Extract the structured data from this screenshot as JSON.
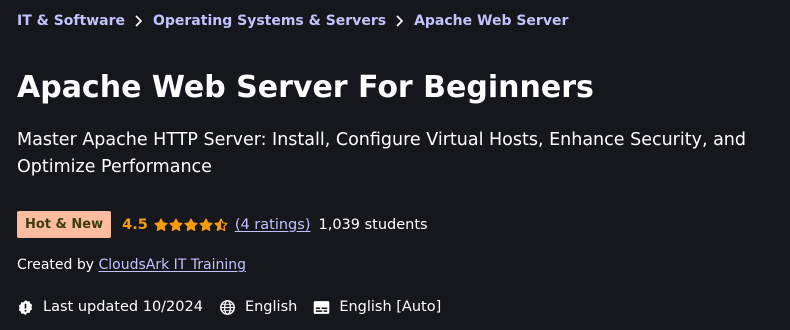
{
  "breadcrumb": {
    "items": [
      {
        "label": "IT & Software"
      },
      {
        "label": "Operating Systems & Servers"
      },
      {
        "label": "Apache Web Server"
      }
    ]
  },
  "course": {
    "title": "Apache Web Server For Beginners",
    "subtitle": "Master Apache HTTP Server: Install, Configure Virtual Hosts, Enhance Security, and Optimize Performance",
    "badge": "Hot & New",
    "rating": "4.5",
    "rating_stars": 4.5,
    "ratings_count": "(4 ratings)",
    "students": "1,039 students",
    "created_by_label": "Created by",
    "instructor": "CloudsArk IT Training",
    "last_updated": "Last updated 10/2024",
    "language": "English",
    "captions": "English [Auto]"
  },
  "colors": {
    "background": "#16161d",
    "link": "#c0c4fc",
    "star": "#f69c08",
    "badge_bg": "#fcbca0",
    "badge_text": "#3d3c0a"
  },
  "icons": {
    "breadcrumb_separator": "chevron-right-icon",
    "star": "star-icon",
    "last_updated": "alert-badge-icon",
    "language": "globe-icon",
    "captions": "closed-captions-icon"
  }
}
